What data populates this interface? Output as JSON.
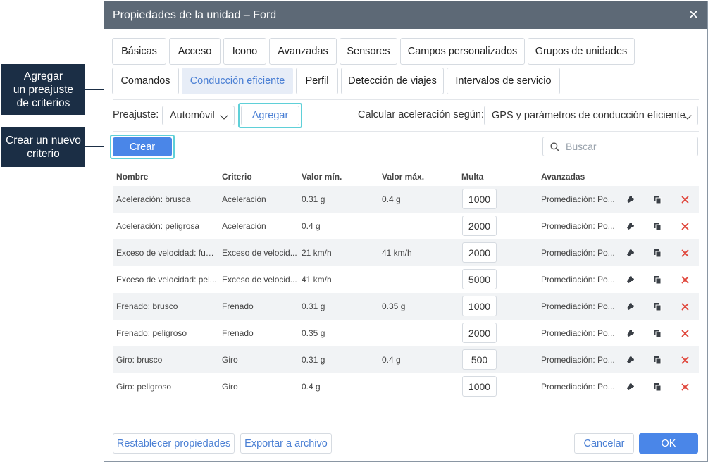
{
  "callouts": {
    "add_preset": "Agregar\nun preajuste\nde criterios",
    "create_criterion": "Crear un nuevo\ncriterio"
  },
  "dialog": {
    "title": "Propiedades de la unidad – Ford",
    "close_icon": "close-icon"
  },
  "tabs": [
    {
      "label": "Básicas"
    },
    {
      "label": "Acceso"
    },
    {
      "label": "Icono"
    },
    {
      "label": "Avanzadas"
    },
    {
      "label": "Sensores"
    },
    {
      "label": "Campos personalizados"
    },
    {
      "label": "Grupos de unidades"
    },
    {
      "label": "Comandos"
    },
    {
      "label": "Conducción eficiente",
      "active": true
    },
    {
      "label": "Perfil"
    },
    {
      "label": "Detección de viajes"
    },
    {
      "label": "Intervalos de servicio"
    }
  ],
  "toolbar": {
    "preset_label": "Preajuste:",
    "preset_value": "Automóvil",
    "add_label": "Agregar",
    "accel_label": "Calcular aceleración según:",
    "accel_value": "GPS y parámetros de conducción eficiente",
    "create_label": "Crear",
    "search_placeholder": "Buscar"
  },
  "table": {
    "headers": [
      "Nombre",
      "Criterio",
      "Valor mín.",
      "Valor máx.",
      "Multa",
      "Avanzadas"
    ],
    "rows": [
      {
        "name": "Aceleración: brusca",
        "criterion": "Aceleración",
        "min": "0.31 g",
        "max": "0.4 g",
        "fine": "1000",
        "advanced": "Promediación: Po..."
      },
      {
        "name": "Aceleración: peligrosa",
        "criterion": "Aceleración",
        "min": "0.4 g",
        "max": "",
        "fine": "2000",
        "advanced": "Promediación: Po..."
      },
      {
        "name": "Exceso de velocidad: fue...",
        "criterion": "Exceso de velocid...",
        "min": "21 km/h",
        "max": "41 km/h",
        "fine": "2000",
        "advanced": "Promediación: Po..."
      },
      {
        "name": "Exceso de velocidad: pel...",
        "criterion": "Exceso de velocid...",
        "min": "41 km/h",
        "max": "",
        "fine": "5000",
        "advanced": "Promediación: Po..."
      },
      {
        "name": "Frenado: brusco",
        "criterion": "Frenado",
        "min": "0.31 g",
        "max": "0.35 g",
        "fine": "1000",
        "advanced": "Promediación: Po..."
      },
      {
        "name": "Frenado: peligroso",
        "criterion": "Frenado",
        "min": "0.35 g",
        "max": "",
        "fine": "2000",
        "advanced": "Promediación: Po..."
      },
      {
        "name": "Giro: brusco",
        "criterion": "Giro",
        "min": "0.31 g",
        "max": "0.4 g",
        "fine": "500",
        "advanced": "Promediación: Po..."
      },
      {
        "name": "Giro: peligroso",
        "criterion": "Giro",
        "min": "0.4 g",
        "max": "",
        "fine": "1000",
        "advanced": "Promediación: Po..."
      }
    ],
    "row_icons": [
      "wrench-icon",
      "copy-icon",
      "delete-icon"
    ]
  },
  "footer": {
    "reset_label": "Restablecer propiedades",
    "export_label": "Exportar a archivo",
    "cancel_label": "Cancelar",
    "ok_label": "OK"
  },
  "colors": {
    "title_bar": "#5d6976",
    "accent": "#4a86e8",
    "highlight": "#5fd0d8",
    "callout_bg": "#1b2e45",
    "delete": "#e0453a"
  }
}
